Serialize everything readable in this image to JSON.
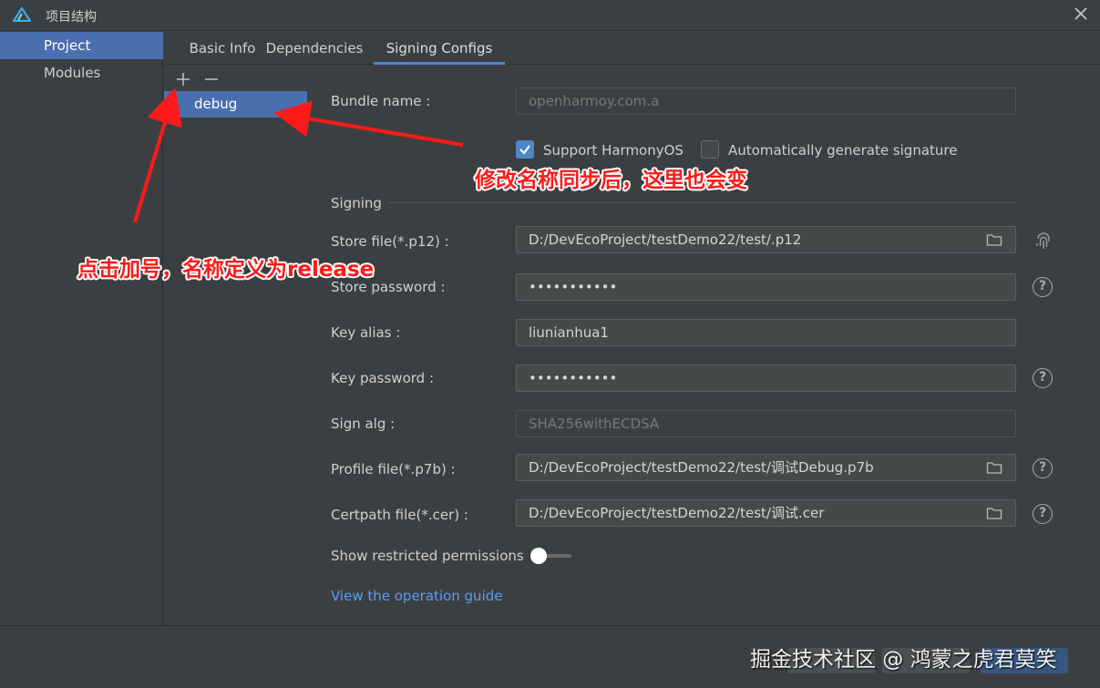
{
  "window": {
    "title": "项目结构",
    "logo_icon": "harmony-logo-icon",
    "close_icon": "close-icon"
  },
  "nav": {
    "items": [
      {
        "label": "Project",
        "active": true
      },
      {
        "label": "Modules",
        "active": false
      }
    ]
  },
  "tabs": [
    {
      "label": "Basic Info"
    },
    {
      "label": "Dependencies"
    },
    {
      "label": "Signing Configs",
      "active": true
    }
  ],
  "configs": {
    "add_icon": "plus-icon",
    "remove_icon": "minus-icon",
    "items": [
      {
        "label": "debug"
      }
    ]
  },
  "form": {
    "bundle_name": {
      "label": "Bundle name :",
      "value": "openharmoy.com.a"
    },
    "support_harmonyos": {
      "label": "Support HarmonyOS",
      "checked": true
    },
    "auto_signature": {
      "label": "Automatically generate signature",
      "checked": false
    },
    "signing_section": "Signing",
    "store_file": {
      "label": "Store file(*.p12) :",
      "value": "D:/DevEcoProject/testDemo22/test/.p12"
    },
    "store_password": {
      "label": "Store password :",
      "value": "•••••••••••"
    },
    "key_alias": {
      "label": "Key alias :",
      "value": "liunianhua1"
    },
    "key_password": {
      "label": "Key password :",
      "value": "•••••••••••"
    },
    "sign_alg": {
      "label": "Sign alg :",
      "value": "SHA256withECDSA"
    },
    "profile_file": {
      "label": "Profile file(*.p7b) :",
      "value": "D:/DevEcoProject/testDemo22/test/调试Debug.p7b"
    },
    "certpath_file": {
      "label": "Certpath file(*.cer) :",
      "value": "D:/DevEcoProject/testDemo22/test/调试.cer"
    },
    "show_restricted": {
      "label": "Show restricted permissions",
      "enabled": false
    },
    "guide_link": "View the operation guide",
    "help_glyph": "?"
  },
  "annotations": {
    "right_note": "修改名称同步后，这里也会变",
    "left_note": "点击加号，名称定义为release",
    "color": "#ff1a1a"
  },
  "watermark": "掘金技术社区 @ 鸿蒙之虎君莫笑",
  "colors": {
    "accent": "#4b6eaf",
    "link": "#589df6",
    "tab_underline": "#4a88c7"
  }
}
